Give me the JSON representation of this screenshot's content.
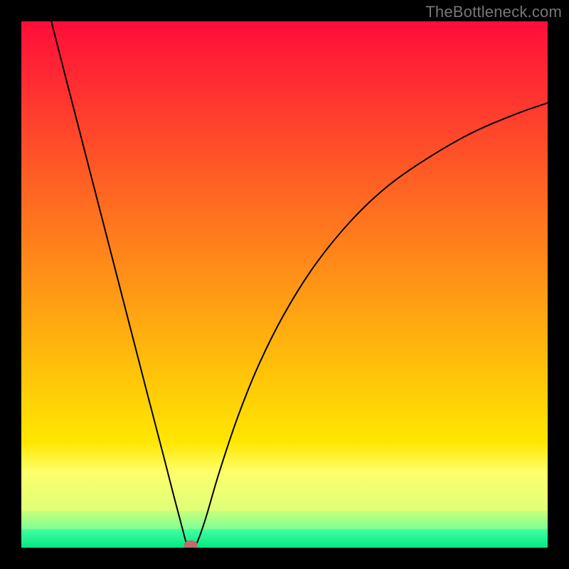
{
  "watermark": "TheBottleneck.com",
  "chart_data": {
    "type": "line",
    "title": "",
    "xlabel": "",
    "ylabel": "",
    "xlim": [
      0,
      100
    ],
    "ylim": [
      0,
      100
    ],
    "gradient_bands": [
      {
        "y0": 0,
        "y1": 0.8,
        "from": "#ff0d3a",
        "to": "#ffe700"
      },
      {
        "y0": 0.8,
        "y1": 0.855,
        "from": "#ffe700",
        "to": "#fdff6b"
      },
      {
        "y0": 0.855,
        "y1": 0.93,
        "from": "#fdff6b",
        "to": "#dfff78"
      },
      {
        "y0": 0.93,
        "y1": 0.965,
        "from": "#c8ff7a",
        "to": "#7aff98"
      },
      {
        "y0": 0.965,
        "y1": 1.0,
        "from": "#44ffa0",
        "to": "#00e884"
      }
    ],
    "series": [
      {
        "name": "bottleneck-curve",
        "color": "#000000",
        "points": [
          {
            "x": 5.7,
            "y": 100.0
          },
          {
            "x": 8.0,
            "y": 91.0
          },
          {
            "x": 12.0,
            "y": 75.5
          },
          {
            "x": 16.0,
            "y": 60.0
          },
          {
            "x": 20.0,
            "y": 44.5
          },
          {
            "x": 24.0,
            "y": 29.0
          },
          {
            "x": 27.0,
            "y": 17.5
          },
          {
            "x": 29.0,
            "y": 9.7
          },
          {
            "x": 30.5,
            "y": 4.0
          },
          {
            "x": 31.5,
            "y": 0.5
          },
          {
            "x": 32.3,
            "y": 0.0
          },
          {
            "x": 33.3,
            "y": 0.8
          },
          {
            "x": 35.0,
            "y": 5.5
          },
          {
            "x": 37.5,
            "y": 14.0
          },
          {
            "x": 41.0,
            "y": 24.5
          },
          {
            "x": 45.0,
            "y": 34.5
          },
          {
            "x": 50.0,
            "y": 44.5
          },
          {
            "x": 56.0,
            "y": 54.0
          },
          {
            "x": 63.0,
            "y": 62.5
          },
          {
            "x": 70.0,
            "y": 69.0
          },
          {
            "x": 78.0,
            "y": 74.5
          },
          {
            "x": 86.0,
            "y": 79.0
          },
          {
            "x": 94.0,
            "y": 82.4
          },
          {
            "x": 100.0,
            "y": 84.5
          }
        ]
      }
    ],
    "marker": {
      "name": "optimal-point",
      "x": 32.2,
      "y": 0.5,
      "rx": 1.3,
      "ry": 0.9,
      "color": "#c06a6a"
    }
  }
}
